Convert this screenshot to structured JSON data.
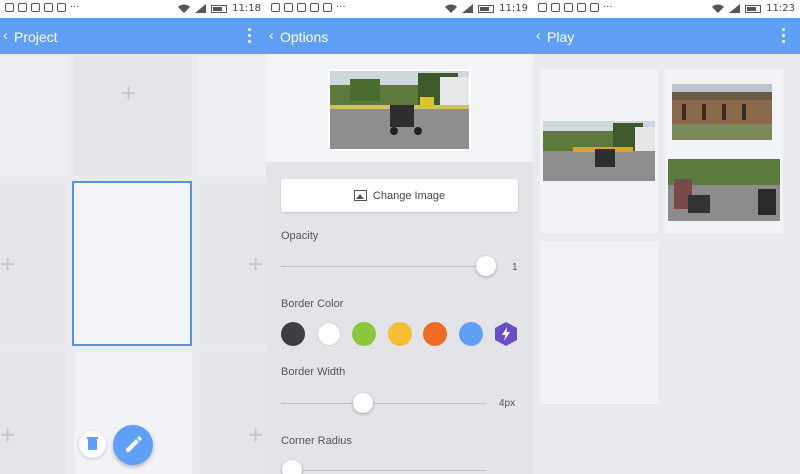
{
  "status_bars": [
    {
      "time": "11:18"
    },
    {
      "time": "11:19"
    },
    {
      "time": "11:23"
    }
  ],
  "screens": {
    "project": {
      "title": "Project",
      "back_icon": "chevron-left-icon",
      "menu_icon": "overflow-menu-icon",
      "add_icon": "plus-icon",
      "fab_small_icon": "trash-icon",
      "fab_icon": "pencil-icon"
    },
    "options": {
      "title": "Options",
      "change_image_label": "Change Image",
      "opacity": {
        "label": "Opacity",
        "value": 1,
        "display": "1"
      },
      "border_color": {
        "label": "Border Color",
        "swatches": [
          "#3d3f42",
          "#ffffff",
          "#8cc63f",
          "#f7bd35",
          "#ef6b24",
          "#5f9ff5"
        ],
        "custom_color": "#6a4cc4",
        "custom_icon": "lightning-icon"
      },
      "border_width": {
        "label": "Border Width",
        "value": 4,
        "max": 10,
        "display": "4px"
      },
      "corner_radius": {
        "label": "Corner Radius",
        "value": 0
      }
    },
    "play": {
      "title": "Play"
    }
  },
  "colors": {
    "appbar": "#5f9ff5",
    "selection_border": "#5e90e0"
  }
}
